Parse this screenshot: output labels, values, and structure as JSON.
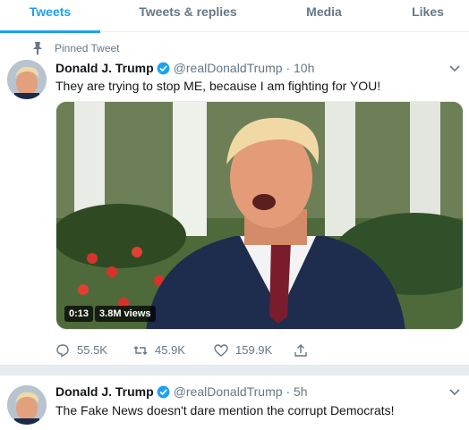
{
  "tabs": [
    {
      "label": "Tweets",
      "active": true
    },
    {
      "label": "Tweets & replies",
      "active": false
    },
    {
      "label": "Media",
      "active": false
    },
    {
      "label": "Likes",
      "active": false
    }
  ],
  "colors": {
    "accent": "#1da1f2",
    "muted": "#657786",
    "text": "#14171a",
    "separator": "#e6ecf0"
  },
  "tweets": [
    {
      "pinned_label": "Pinned Tweet",
      "author_name": "Donald J. Trump",
      "handle": "@realDonaldTrump",
      "dot": "·",
      "time": "10h",
      "text": "They are trying to stop ME, because I am fighting for YOU!",
      "video": {
        "duration": "0:13",
        "views": "3.8M views"
      },
      "actions": {
        "replies": "55.5K",
        "retweets": "45.9K",
        "likes": "159.9K"
      },
      "icons": {
        "pin": "pin-icon",
        "verified": "verified-badge-icon",
        "caret": "chevron-down-icon",
        "reply": "reply-icon",
        "retweet": "retweet-icon",
        "like": "heart-icon",
        "share": "share-icon"
      }
    },
    {
      "author_name": "Donald J. Trump",
      "handle": "@realDonaldTrump",
      "dot": "·",
      "time": "5h",
      "text": "The Fake News doesn't dare mention the corrupt Democrats!",
      "icons": {
        "verified": "verified-badge-icon",
        "caret": "chevron-down-icon"
      }
    }
  ]
}
